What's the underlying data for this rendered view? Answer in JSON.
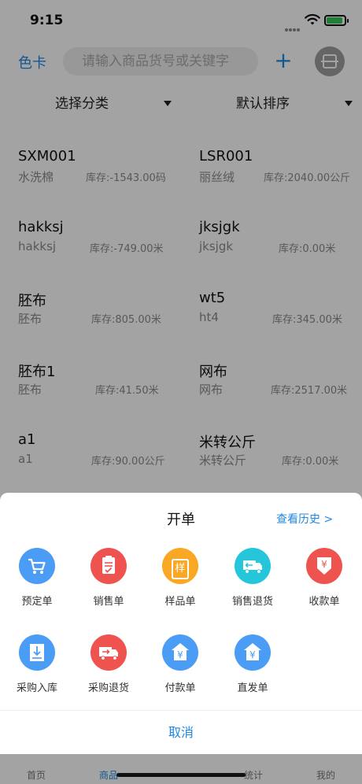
{
  "status": {
    "time": "9:15"
  },
  "header": {
    "left_label": "色卡",
    "search_placeholder": "请输入商品货号或关键字",
    "add_label": "+"
  },
  "filters": {
    "category": "选择分类",
    "sort": "默认排序"
  },
  "products": [
    {
      "name": "SXM001",
      "sub": "水洗棉",
      "stock": "库存:-1543.00码"
    },
    {
      "name": "LSR001",
      "sub": "丽丝绒",
      "stock": "库存:2040.00公斤"
    },
    {
      "name": "hakksj",
      "sub": "hakksj",
      "stock": "库存:-749.00米"
    },
    {
      "name": "jksjgk",
      "sub": "jksjgk",
      "stock": "库存:0.00米"
    },
    {
      "name": "胚布",
      "sub": "胚布",
      "stock": "库存:805.00米"
    },
    {
      "name": "wt5",
      "sub": "ht4",
      "stock": "库存:345.00米"
    },
    {
      "name": "胚布1",
      "sub": "胚布",
      "stock": "库存:41.50米"
    },
    {
      "name": "网布",
      "sub": "网布",
      "stock": "库存:2517.00米"
    },
    {
      "name": "a1",
      "sub": "a1",
      "stock": "库存:90.00公斤"
    },
    {
      "name": "米转公斤",
      "sub": "米转公斤",
      "stock": "库存:0.00米"
    }
  ],
  "sheet": {
    "title": "开单",
    "history": "查看历史 >",
    "cancel": "取消",
    "actions": [
      {
        "label": "预定单",
        "icon": "cart-icon",
        "color": "#4a9cf4"
      },
      {
        "label": "销售单",
        "icon": "clipboard-check-icon",
        "color": "#ef5350"
      },
      {
        "label": "样品单",
        "icon": "sample-bag-icon",
        "color": "#f9a825",
        "glyph": "样"
      },
      {
        "label": "销售退货",
        "icon": "delivery-truck-icon",
        "color": "#26c6da"
      },
      {
        "label": "收款单",
        "icon": "receipt-yen-icon",
        "color": "#ef5350",
        "glyph": "¥"
      },
      {
        "label": "采购入库",
        "icon": "download-box-icon",
        "color": "#4a9cf4"
      },
      {
        "label": "采购退货",
        "icon": "return-truck-icon",
        "color": "#ef5350"
      },
      {
        "label": "付款单",
        "icon": "house-yen-icon",
        "color": "#4a9cf4",
        "glyph": "¥"
      },
      {
        "label": "直发单",
        "icon": "house-yen-icon",
        "color": "#4a9cf4",
        "glyph": "¥"
      }
    ]
  },
  "tabbar": {
    "tabs": [
      "首页",
      "商品",
      "统计",
      "我的"
    ],
    "active": "商品"
  }
}
